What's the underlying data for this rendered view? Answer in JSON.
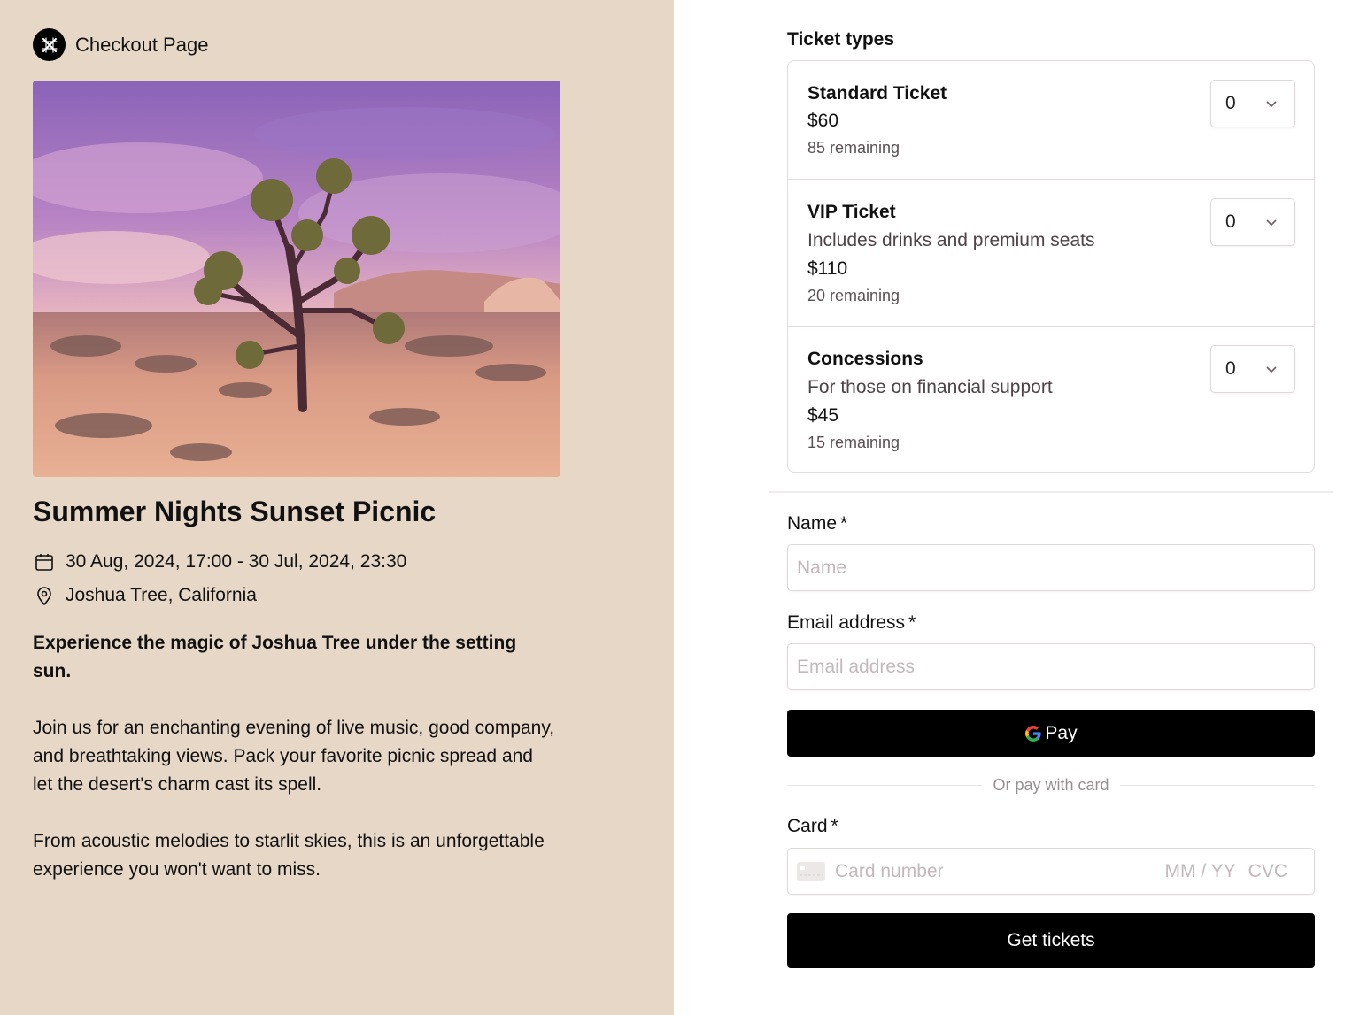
{
  "brand": {
    "name": "Checkout Page",
    "logo_icon": "asterisk-cross-icon"
  },
  "event": {
    "image_alt": "Joshua tree in desert at sunset",
    "title": "Summer Nights Sunset Picnic",
    "date_range": "30 Aug, 2024, 17:00 - 30 Jul, 2024, 23:30",
    "location": "Joshua Tree, California",
    "description": {
      "lead": "Experience the magic of Joshua Tree under the setting sun.",
      "paragraphs": [
        "Join us for an enchanting evening of live music, good company, and breathtaking views. Pack your favorite picnic spread and let the desert's charm cast its spell.",
        "From acoustic melodies to starlit skies, this is an unforgettable experience you won't want to miss."
      ]
    }
  },
  "tickets": {
    "heading": "Ticket types",
    "items": [
      {
        "name": "Standard Ticket",
        "description": "",
        "price": "$60",
        "remaining": "85 remaining",
        "quantity": "0"
      },
      {
        "name": "VIP Ticket",
        "description": "Includes drinks and premium seats",
        "price": "$110",
        "remaining": "20 remaining",
        "quantity": "0"
      },
      {
        "name": "Concessions",
        "description": "For those on financial support",
        "price": "$45",
        "remaining": "15 remaining",
        "quantity": "0"
      }
    ]
  },
  "form": {
    "name": {
      "label": "Name",
      "required_mark": "*",
      "placeholder": "Name",
      "value": ""
    },
    "email": {
      "label": "Email address",
      "required_mark": "*",
      "placeholder": "Email address",
      "value": ""
    },
    "gpay_label": "Pay",
    "divider_text": "Or pay with card",
    "card": {
      "label": "Card",
      "required_mark": "*",
      "number_placeholder": "Card number",
      "expiry_placeholder": "MM / YY",
      "cvc_placeholder": "CVC"
    },
    "submit_label": "Get tickets"
  },
  "colors": {
    "left_panel_bg": "#e6d7c7",
    "button_bg": "#000000",
    "placeholder": "#c4b8bb"
  }
}
